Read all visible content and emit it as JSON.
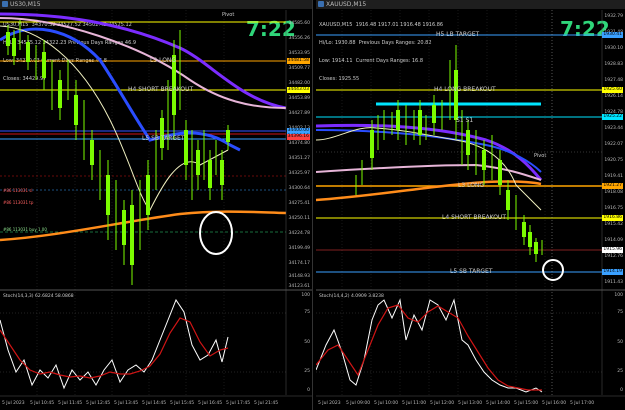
{
  "left": {
    "title": "US30,M15",
    "info": [
      "US30,M15  34370.32 34527.52 34502.42 34525.12",
      "Hi/Lo 34575.12 34322.23 Previous Days Ranges 46.9",
      "Low: 34270.03 Current Days Ranges 45.8",
      "Closes: 34429.97"
    ],
    "clock": "7:22",
    "pivot": "Pivot",
    "levels": {
      "l3": "L3 LONG",
      "h4": "H4 SHORT BREAKOUT",
      "l5": "L5 SB TARGET"
    },
    "markers": [
      "#86 113031 sl",
      "#86 113031 tp",
      "#86 113031 buy 1.00"
    ],
    "prices": [
      "34585.60",
      "34556.26",
      "34533.95",
      "34509.77",
      "34482.00",
      "34453.89",
      "34427.89",
      "34402.13",
      "34374.80",
      "34351.27",
      "34325.97",
      "34300.64",
      "34275.41",
      "34250.11",
      "34224.78",
      "34199.49",
      "34174.17",
      "34148.93",
      "34123.61"
    ],
    "tags": [
      {
        "text": "34481.58",
        "color": "#ffa500"
      },
      {
        "text": "34443.03",
        "color": "#ffff00"
      },
      {
        "text": "34400.00",
        "color": "#3aa0ff"
      },
      {
        "text": "34396.16",
        "color": "#ff4040"
      }
    ],
    "stoch_title": "Stoch(14,3,3) 62.6824 58.0868",
    "stoch_levels": [
      "100",
      "75",
      "50",
      "25",
      "0"
    ],
    "times": [
      "5 Jul 2023",
      "5 Jul 10:45",
      "5 Jul 11:45",
      "5 Jul 12:45",
      "5 Jul 13:45",
      "5 Jul 14:45",
      "5 Jul 15:45",
      "5 Jul 16:45",
      "5 Jul 17:45",
      "5 Jul 21:45"
    ]
  },
  "right": {
    "title": "XAUUSD,M15",
    "info": [
      "XAUUSD,M15  1916.48 1917.01 1916.48 1916.86",
      "Hi/Lo: 1930.88  Previous Days Ranges: 20.82",
      "Low: 1914.11  Current Days Ranges: 16.8",
      "Closes: 1925.55"
    ],
    "clock": "7:22",
    "pivot": "Pivot",
    "levels": {
      "h5": "H5 LB TARGET",
      "h4": "H4 LONG BREAKOUT",
      "s1": "S1 S1",
      "l3": "L3 LONG",
      "l4": "L4 SHORT BREAKOUT",
      "l5": "L5 SB TARGET"
    },
    "prices": [
      "1932.79",
      "1931.48",
      "1930.10",
      "1928.83",
      "1927.48",
      "1926.14",
      "1924.78",
      "1923.44",
      "1922.07",
      "1920.75",
      "1919.41",
      "1918.08",
      "1916.75",
      "1915.42",
      "1914.09",
      "1912.76",
      "1911.43"
    ],
    "tags": [
      {
        "text": "1930.41",
        "color": "#3aa0ff"
      },
      {
        "text": "1925.60",
        "color": "#ffff00"
      },
      {
        "text": "1925.22",
        "color": "#00e5ff"
      },
      {
        "text": "1921.27",
        "color": "#ffa500"
      },
      {
        "text": "1916.86",
        "color": "#ffff00"
      },
      {
        "text": "1915.96",
        "color": "#ffffff"
      },
      {
        "text": "1914.19",
        "color": "#3aa0ff"
      }
    ],
    "stoch_title": "Stoch(14,4,2) 4.0909 3.8238",
    "stoch_levels": [
      "100",
      "75",
      "50",
      "25",
      "0"
    ],
    "times": [
      "5 Jul 2023",
      "5 Jul 09:00",
      "5 Jul 10:00",
      "5 Jul 11:00",
      "5 Jul 12:00",
      "5 Jul 13:00",
      "5 Jul 14:00",
      "5 Jul 15:00",
      "5 Jul 16:00",
      "5 Jul 17:00"
    ]
  },
  "colors": {
    "clock": "#2fd67a",
    "candle": "#7cfc00",
    "stoch_main": "#ffffff",
    "stoch_signal": "#d01515"
  }
}
